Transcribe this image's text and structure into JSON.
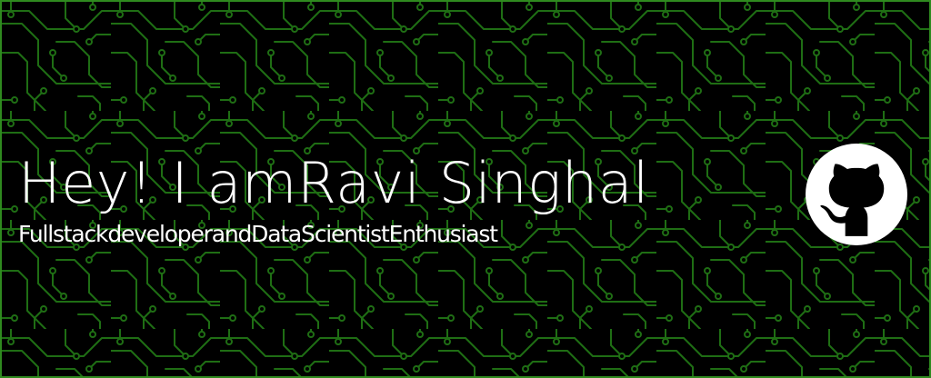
{
  "hero": {
    "greeting": "Hey! I am",
    "name": "Ravi Singhal",
    "tagline": "FullstackdeveloperandDataScientistEnthusiast"
  },
  "social": {
    "github_icon": "github-octocat-icon"
  },
  "colors": {
    "background": "#000000",
    "circuit_trace": "#1f6e14",
    "frame": "#2f8a1f",
    "text": "#ffffff"
  }
}
